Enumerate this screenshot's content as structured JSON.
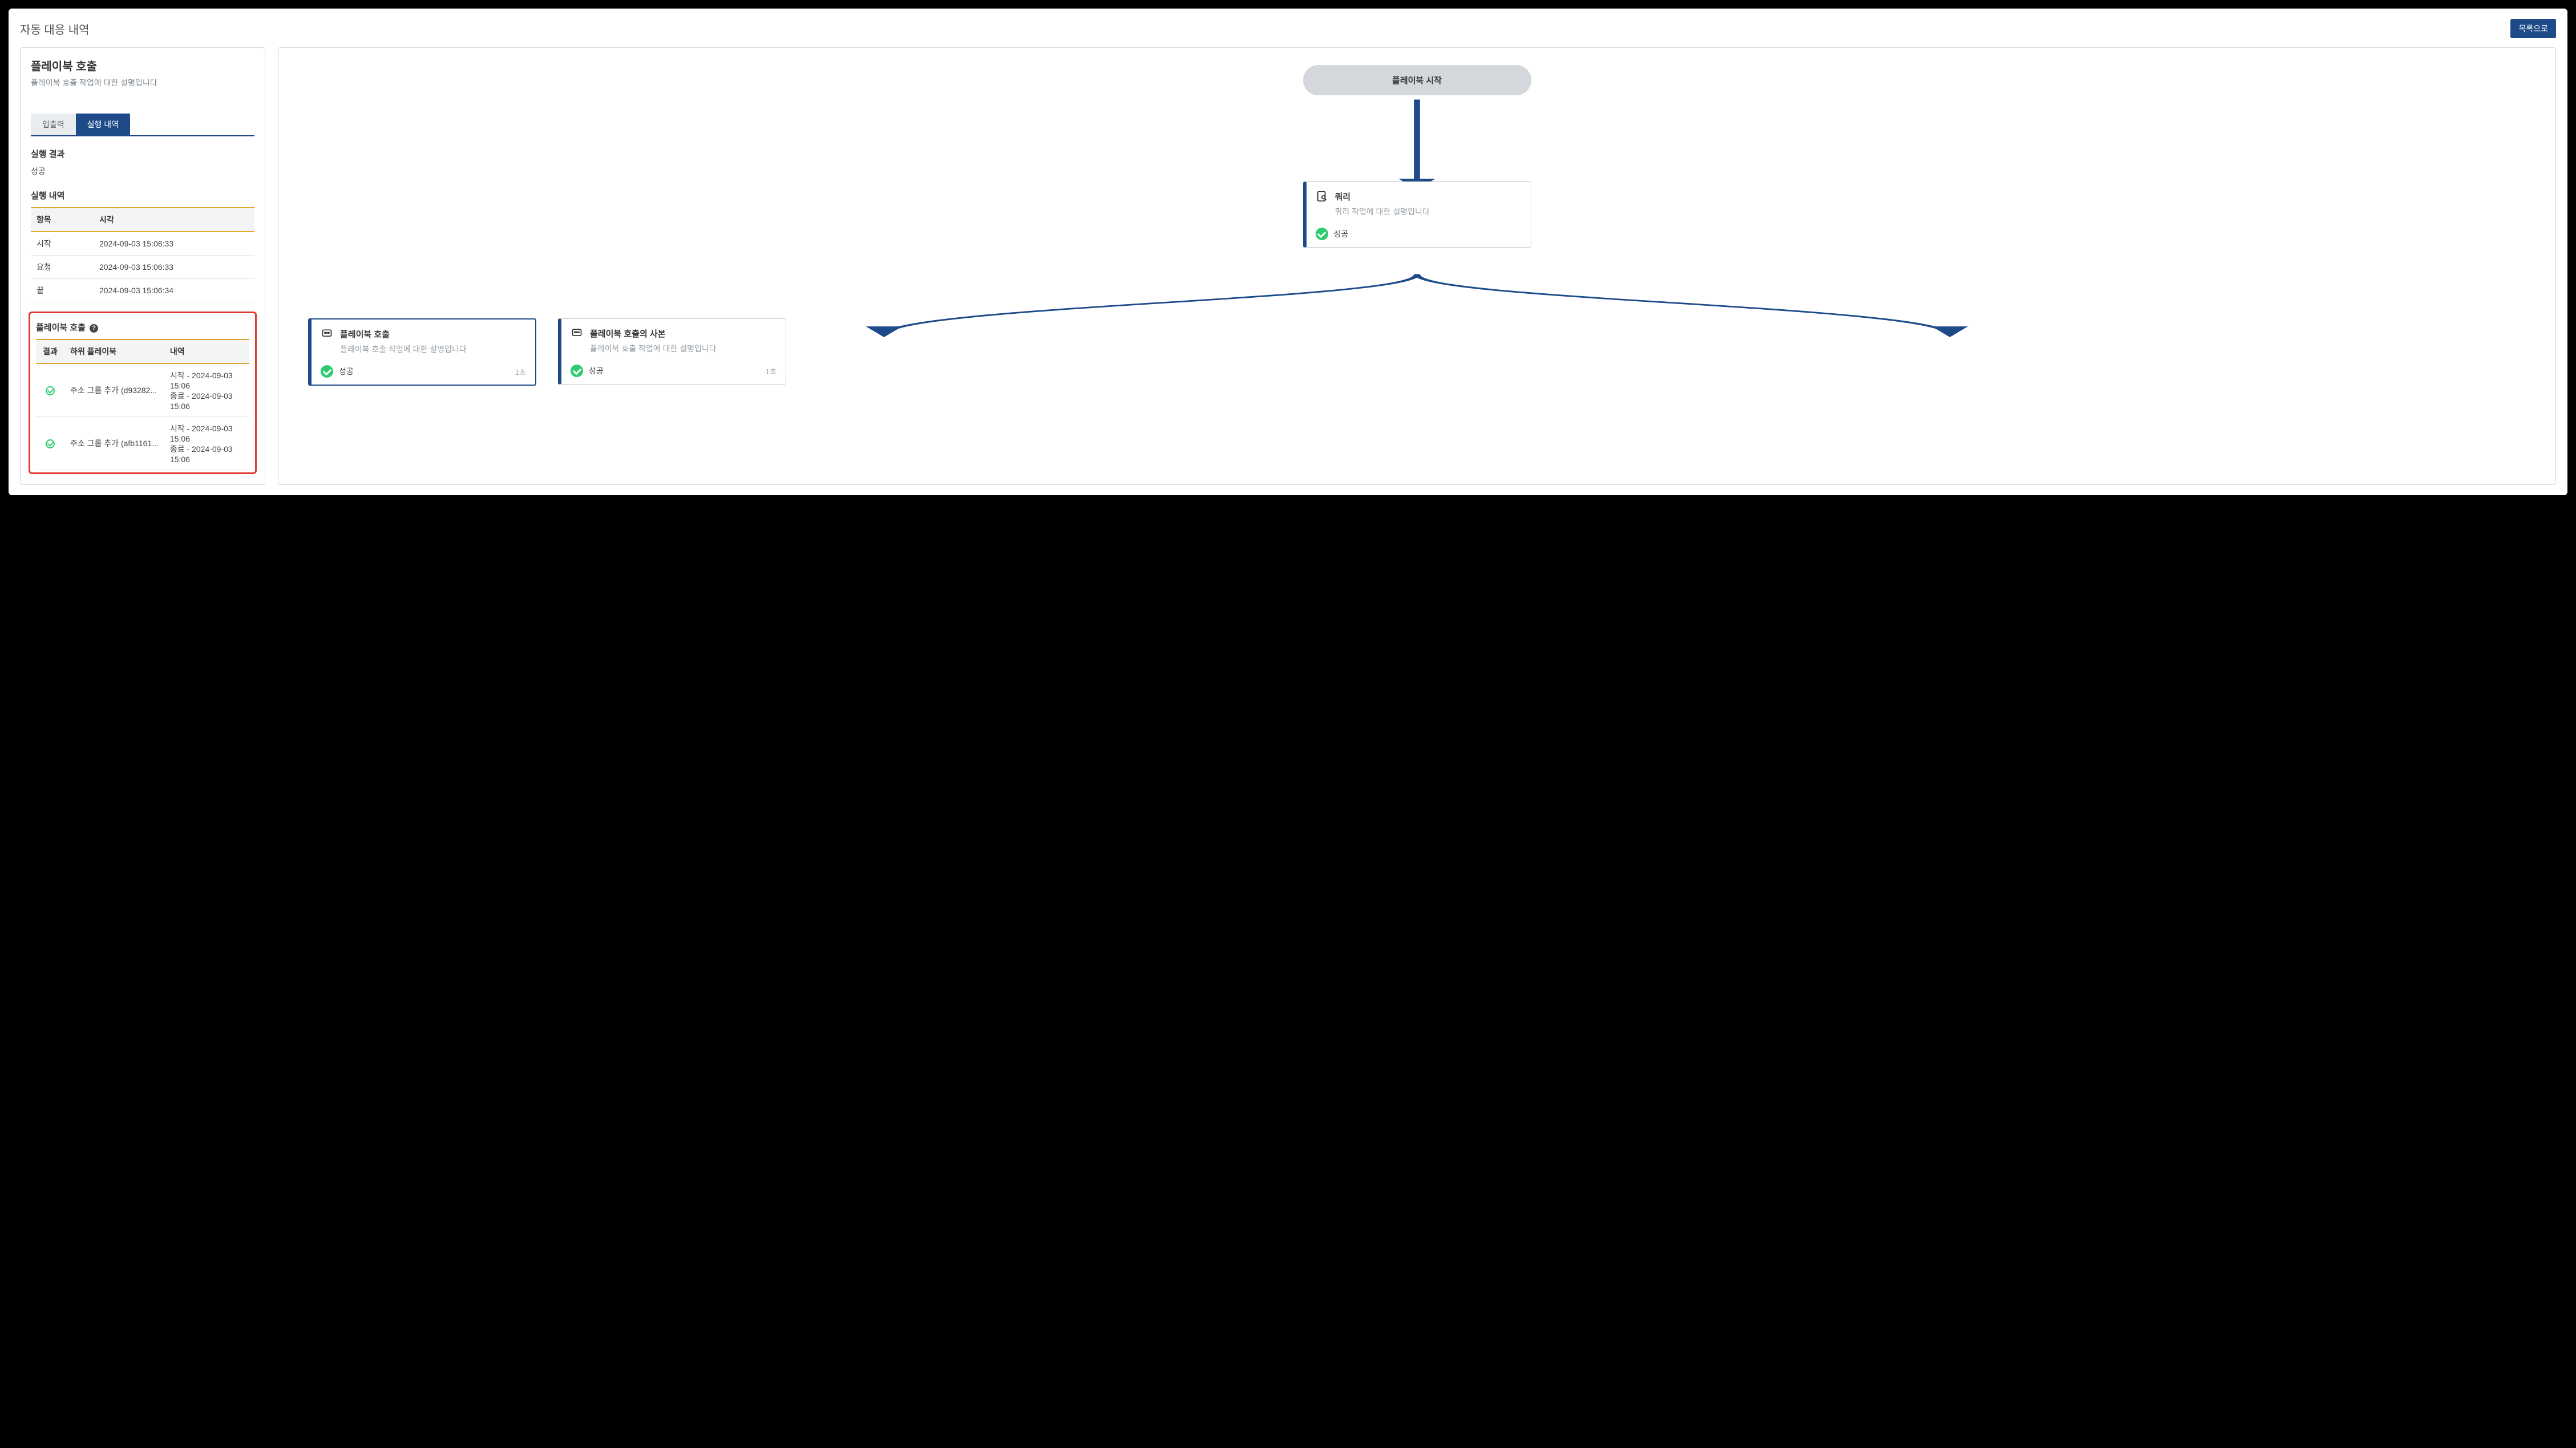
{
  "header": {
    "title": "자동 대응 내역",
    "list_button": "목록으로"
  },
  "left": {
    "title": "플레이북 호출",
    "desc": "플레이북 호출 작업에 대한 설명입니다",
    "tabs": {
      "inactive": "입출력",
      "active": "실행 내역"
    },
    "result_heading": "실행 결과",
    "result_value": "성공",
    "history_heading": "실행 내역",
    "history_cols": {
      "item": "항목",
      "time": "시각"
    },
    "history_rows": [
      {
        "item": "시작",
        "time": "2024-09-03 15:06:33"
      },
      {
        "item": "요청",
        "time": "2024-09-03 15:06:33"
      },
      {
        "item": "끝",
        "time": "2024-09-03 15:06:34"
      }
    ],
    "pb_heading": "플레이북 호출",
    "pb_cols": {
      "result": "결과",
      "sub": "하위 플레이북",
      "detail": "내역"
    },
    "pb_rows": [
      {
        "sub": "주소 그룹 추가 (d93282...",
        "start": "시작 - 2024-09-03 15:06",
        "end": "종료 - 2024-09-03 15:06"
      },
      {
        "sub": "주소 그룹 추가 (afb1161...",
        "start": "시작 - 2024-09-03 15:06",
        "end": "종료 - 2024-09-03 15:06"
      }
    ]
  },
  "flow": {
    "start": "플레이북 시작",
    "node1": {
      "title": "쿼리",
      "desc": "쿼리 작업에 대한 설명입니다",
      "status": "성공"
    },
    "node2": {
      "title": "플레이북 호출",
      "desc": "플레이북 호출 작업에 대한 설명입니다",
      "status": "성공",
      "time": "1초"
    },
    "node3": {
      "title": "플레이북 호출의 사본",
      "desc": "플레이북 호출 작업에 대한 설명입니다",
      "status": "성공",
      "time": "1초"
    }
  }
}
